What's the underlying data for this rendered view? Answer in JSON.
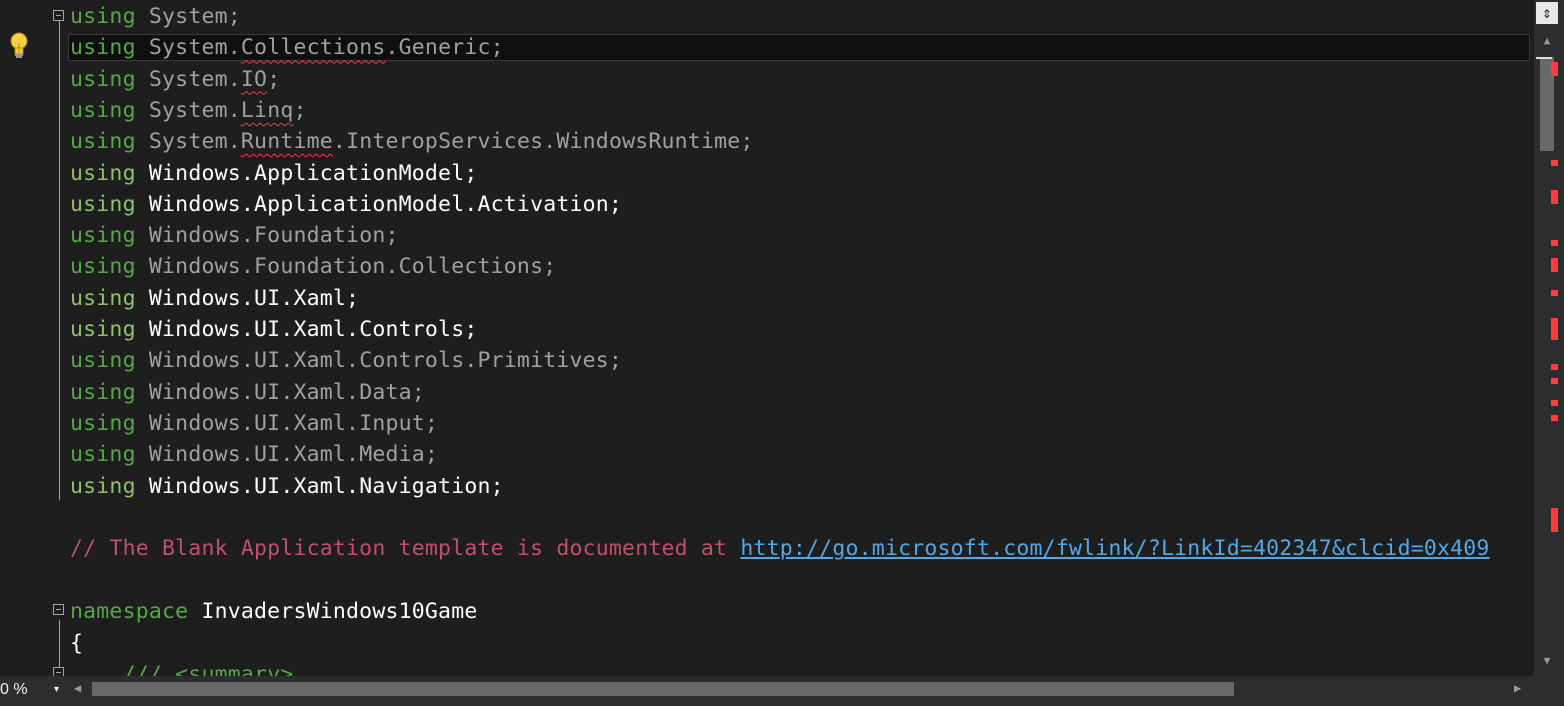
{
  "code_lines": [
    {
      "kw": "using",
      "ns": "System;",
      "used": false
    },
    {
      "kw": "using",
      "ns": "System.Collections.Generic;",
      "used": false
    },
    {
      "kw": "using",
      "ns": "System.IO;",
      "used": false
    },
    {
      "kw": "using",
      "ns": "System.Linq;",
      "used": false
    },
    {
      "kw": "using",
      "ns": "System.Runtime.InteropServices.WindowsRuntime;",
      "used": false
    },
    {
      "kw": "using",
      "ns": "Windows.ApplicationModel;",
      "used": true
    },
    {
      "kw": "using",
      "ns": "Windows.ApplicationModel.Activation;",
      "used": true
    },
    {
      "kw": "using",
      "ns": "Windows.Foundation;",
      "used": false
    },
    {
      "kw": "using",
      "ns": "Windows.Foundation.Collections;",
      "used": false
    },
    {
      "kw": "using",
      "ns": "Windows.UI.Xaml;",
      "used": true
    },
    {
      "kw": "using",
      "ns": "Windows.UI.Xaml.Controls;",
      "used": true
    },
    {
      "kw": "using",
      "ns": "Windows.UI.Xaml.Controls.Primitives;",
      "used": false
    },
    {
      "kw": "using",
      "ns": "Windows.UI.Xaml.Data;",
      "used": false
    },
    {
      "kw": "using",
      "ns": "Windows.UI.Xaml.Input;",
      "used": false
    },
    {
      "kw": "using",
      "ns": "Windows.UI.Xaml.Media;",
      "used": false
    },
    {
      "kw": "using",
      "ns": "Windows.UI.Xaml.Navigation;",
      "used": true
    }
  ],
  "comment": {
    "text": "// The Blank Application template is documented at ",
    "link": "http://go.microsoft.com/fwlink/?LinkId=402347&clcid=0x409"
  },
  "namespace_kw": "namespace",
  "namespace_name": "InvadersWindows10Game",
  "open_brace": "{",
  "summary_line": "    /// <summary>",
  "zoom": "0 %",
  "icons": {
    "lightbulb": "lightbulb-icon",
    "splitter": "splitter-icon",
    "scroll_up": "▲",
    "scroll_down": "▼",
    "scroll_left": "◀",
    "scroll_right": "▶",
    "zoom_dropdown": "▾"
  },
  "colors": {
    "background": "#1e1e1e",
    "keyword_green": "#57a64a",
    "comment_rose": "#c44d6e",
    "link_blue": "#4fa8e8",
    "error_marker": "#ff3b3b"
  }
}
